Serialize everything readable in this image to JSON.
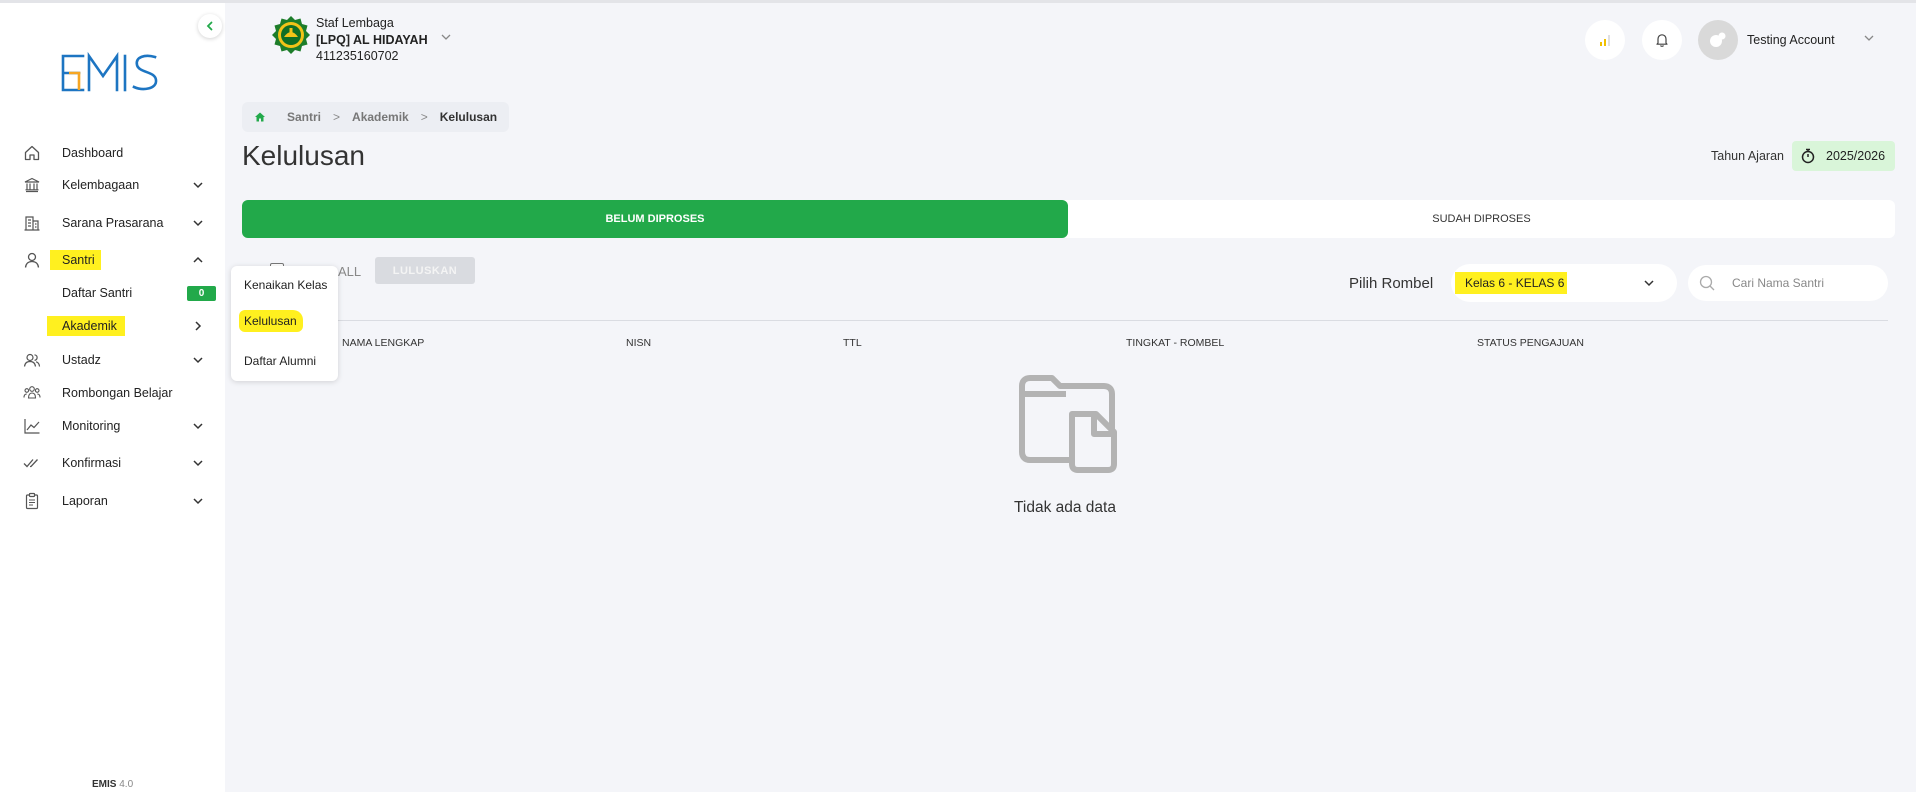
{
  "app": {
    "brand": "EMIS",
    "version_name": "EMIS",
    "version_number": "4.0",
    "accent_color": "#22a94a",
    "highlight_color": "#fff01f"
  },
  "header": {
    "org_role": "Staf Lembaga",
    "org_name": "[LPQ] AL HIDAYAH",
    "org_id": "411235160702",
    "account_name": "Testing Account"
  },
  "sidebar": {
    "items": [
      {
        "label": "Dashboard",
        "icon": "home-icon"
      },
      {
        "label": "Kelembagaan",
        "icon": "institution-icon"
      },
      {
        "label": "Sarana Prasarana",
        "icon": "building-icon"
      },
      {
        "label": "Santri",
        "icon": "user-icon"
      },
      {
        "label": "Daftar Santri",
        "badge": "0"
      },
      {
        "label": "Akademik"
      },
      {
        "label": "Ustadz",
        "icon": "users-icon"
      },
      {
        "label": "Rombongan Belajar",
        "icon": "group-icon"
      },
      {
        "label": "Monitoring",
        "icon": "chart-line-icon"
      },
      {
        "label": "Konfirmasi",
        "icon": "double-check-icon"
      },
      {
        "label": "Laporan",
        "icon": "clipboard-icon"
      }
    ]
  },
  "submenu": {
    "items": [
      "Kenaikan Kelas",
      "Kelulusan",
      "Daftar Alumni"
    ]
  },
  "breadcrumb": {
    "items": [
      "Santri",
      "Akademik",
      "Kelulusan"
    ],
    "separator": ">"
  },
  "page": {
    "title": "Kelulusan",
    "tahun_label": "Tahun Ajaran",
    "tahun_value": "2025/2026"
  },
  "tabs": {
    "active": "BELUM DIPROSES",
    "inactive": "SUDAH DIPROSES"
  },
  "toolbar": {
    "all_label": "ALL",
    "luluskan_label": "LULUSKAN",
    "rombel_label": "Pilih Rombel",
    "rombel_value": "Kelas 6 - KELAS 6",
    "search_placeholder": "Cari Nama Santri"
  },
  "table": {
    "columns": [
      "NAMA LENGKAP",
      "NISN",
      "TTL",
      "TINGKAT - ROMBEL",
      "STATUS PENGAJUAN"
    ],
    "empty_text": "Tidak ada data"
  }
}
